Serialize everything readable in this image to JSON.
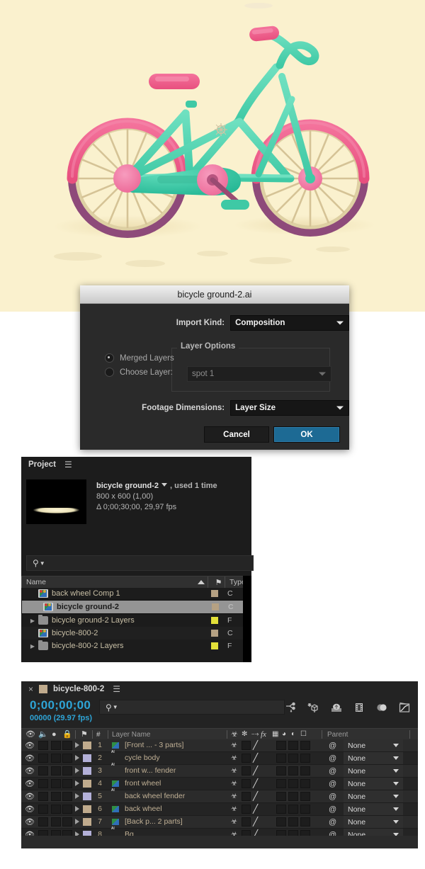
{
  "illustration": {
    "name": "bicycle-illustration",
    "background_color": "#faf1ce",
    "colors": {
      "frame_teal": "#5fd6b4",
      "frame_teal_dark": "#2fc09a",
      "tire_pink": "#ef5d8e",
      "rim_purple": "#8e4a7a",
      "spokes_tan": "#d9c79a",
      "hub_pink": "#f07fa9",
      "seat_pink": "#ef5d8e",
      "shadow": "#efe3bd"
    }
  },
  "dialog": {
    "title": "bicycle ground-2.ai",
    "import_kind": {
      "label": "Import Kind:",
      "value": "Composition"
    },
    "layer_options": {
      "legend": "Layer Options",
      "merged_layers": {
        "label": "Merged Layers",
        "selected": true
      },
      "choose_layer": {
        "label": "Choose Layer:",
        "selected": false,
        "value": "spot 1"
      }
    },
    "footage_dimensions": {
      "label": "Footage Dimensions:",
      "value": "Layer Size"
    },
    "buttons": {
      "cancel": "Cancel",
      "ok": "OK"
    }
  },
  "project": {
    "tab_label": "Project",
    "menu_icon": "hamburger-icon",
    "info": {
      "item_name": "bicycle ground-2",
      "used": ", used 1 time",
      "dimensions": "800 x 600 (1,00)",
      "duration": "Δ 0;00;30;00, 29,97 fps"
    },
    "search_placeholder": "",
    "columns": {
      "name": "Name",
      "tag": "tag-icon",
      "type": "Type"
    },
    "items": [
      {
        "name": "back wheel Comp 1",
        "icon": "comp-icon",
        "indent": false,
        "swatch": "#b5a183",
        "type": "C",
        "selected": false
      },
      {
        "name": "bicycle ground-2",
        "icon": "comp-icon",
        "indent": false,
        "swatch": "#b5a183",
        "type": "C",
        "selected": true
      },
      {
        "name": "bicycle ground-2 Layers",
        "icon": "folder-icon",
        "indent": true,
        "swatch": "#e3e039",
        "type": "F",
        "selected": false
      },
      {
        "name": "bicycle-800-2",
        "icon": "comp-icon",
        "indent": false,
        "swatch": "#b5a183",
        "type": "C",
        "selected": false
      },
      {
        "name": "bicycle-800-2 Layers",
        "icon": "folder-icon",
        "indent": true,
        "swatch": "#e3e039",
        "type": "F",
        "selected": false
      }
    ]
  },
  "timeline": {
    "tab_label": "bicycle-800-2",
    "close_icon": "close-icon",
    "tab_swatch": "#c0ab8d",
    "menu_icon": "hamburger-icon",
    "timecode": "0;00;00;00",
    "frames": "00000 (29.97 fps)",
    "search_placeholder": "",
    "tool_icons": [
      "live-update-icon",
      "draft-3d-icon",
      "hide-shy-layers-icon",
      "frame-blending-icon",
      "motion-blur-icon",
      "graph-editor-icon"
    ],
    "columns": {
      "video": "eye-icon",
      "audio": "speaker-icon",
      "solo": "solo-icon",
      "lock": "lock-icon",
      "label": "tag-icon",
      "number": "#",
      "layer_name": "Layer Name",
      "switches": [
        "shy-icon",
        "collapse-icon",
        "quality-icon",
        "effects-icon",
        "frame-blend-icon",
        "motion-blur-icon",
        "adjustment-icon",
        "3d-icon"
      ],
      "parent": "Parent"
    },
    "rows": [
      {
        "num": "1",
        "name": "[Front ... - 3 parts]",
        "icon": "comp-icon",
        "swatch": "#c0ab8d",
        "parent": "None",
        "visible": true
      },
      {
        "num": "2",
        "name": "cycle body",
        "icon": "ai-icon",
        "swatch": "#b3b0d8",
        "parent": "None",
        "visible": true
      },
      {
        "num": "3",
        "name": "front w... fender",
        "icon": "ai-icon",
        "swatch": "#b3b0d8",
        "parent": "None",
        "visible": true
      },
      {
        "num": "4",
        "name": "front wheel",
        "icon": "comp-icon",
        "swatch": "#c0ab8d",
        "parent": "None",
        "visible": true
      },
      {
        "num": "5",
        "name": "back wheel fender",
        "icon": "ai-icon",
        "swatch": "#b3b0d8",
        "parent": "None",
        "visible": true
      },
      {
        "num": "6",
        "name": "back wheel",
        "icon": "comp-icon",
        "swatch": "#c0ab8d",
        "parent": "None",
        "visible": true
      },
      {
        "num": "7",
        "name": "[Back p... 2 parts]",
        "icon": "comp-icon",
        "swatch": "#c0ab8d",
        "parent": "None",
        "visible": true
      },
      {
        "num": "8",
        "name": "Bg",
        "icon": "ai-icon",
        "swatch": "#b3b0d8",
        "parent": "None",
        "visible": true
      }
    ]
  }
}
